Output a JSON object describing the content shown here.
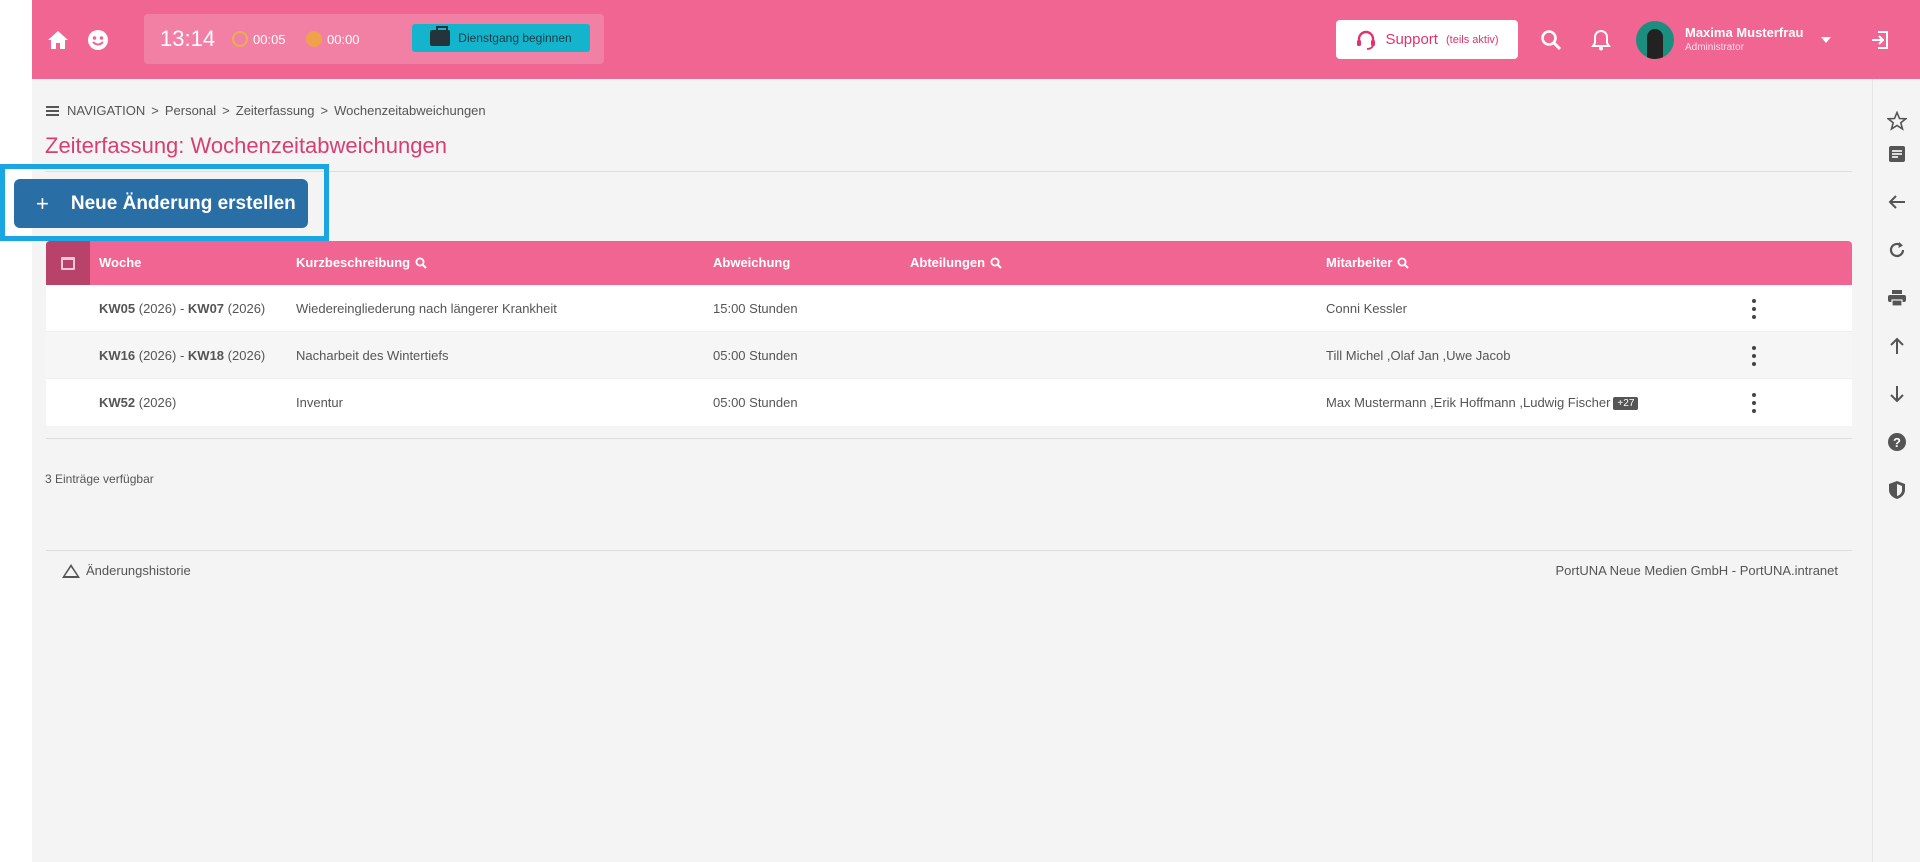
{
  "topbar": {
    "clock": "13:14",
    "timer1": "00:05",
    "timer2": "00:00",
    "dienstgang_label": "Dienstgang beginnen",
    "support_label": "Support",
    "support_note": "(teils aktiv)",
    "user_name": "Maxima Musterfrau",
    "user_role": "Administrator"
  },
  "breadcrumb": {
    "nav": "NAVIGATION",
    "items": [
      "Personal",
      "Zeiterfassung",
      "Wochenzeitabweichungen"
    ]
  },
  "page": {
    "title": "Zeiterfassung: Wochenzeitabweichungen",
    "new_button": "Neue Änderung erstellen",
    "count_text": "3 Einträge verfügbar"
  },
  "table": {
    "headers": {
      "woche": "Woche",
      "kurz": "Kurzbeschreibung",
      "abweichung": "Abweichung",
      "abteilungen": "Abteilungen",
      "mitarbeiter": "Mitarbeiter"
    },
    "rows": [
      {
        "week_a": "KW05",
        "year_a": "(2026)",
        "sep": "-",
        "week_b": "KW07",
        "year_b": "(2026)",
        "description": "Wiedereingliederung nach längerer Krankheit",
        "deviation": "15:00 Stunden",
        "departments": "",
        "employees": "Conni Kessler",
        "badge": ""
      },
      {
        "week_a": "KW16",
        "year_a": "(2026)",
        "sep": "-",
        "week_b": "KW18",
        "year_b": "(2026)",
        "description": "Nacharbeit des Wintertiefs",
        "deviation": "05:00 Stunden",
        "departments": "",
        "employees": "Till Michel ,Olaf Jan ,Uwe Jacob",
        "badge": ""
      },
      {
        "week_a": "KW52",
        "year_a": "(2026)",
        "sep": "",
        "week_b": "",
        "year_b": "",
        "description": "Inventur",
        "deviation": "05:00 Stunden",
        "departments": "",
        "employees": "Max Mustermann ,Erik Hoffmann ,Ludwig Fischer",
        "badge": "+27"
      }
    ]
  },
  "footer": {
    "history": "Änderungshistorie",
    "company": "PortUNA Neue Medien GmbH - PortUNA.intranet"
  },
  "colors": {
    "brand": "#f06592",
    "primary_button": "#2a6ea6",
    "highlight": "#1aa6e0",
    "dienstgang": "#14b5cc"
  },
  "icons": {
    "top": [
      "home-icon",
      "emoji-icon",
      "search-icon",
      "bell-icon",
      "chevron-down-icon",
      "logout-icon"
    ],
    "right": [
      "star-icon",
      "notes-icon",
      "arrow-left-icon",
      "refresh-icon",
      "print-icon",
      "arrow-up-icon",
      "arrow-down-icon",
      "help-icon",
      "shield-icon"
    ]
  }
}
